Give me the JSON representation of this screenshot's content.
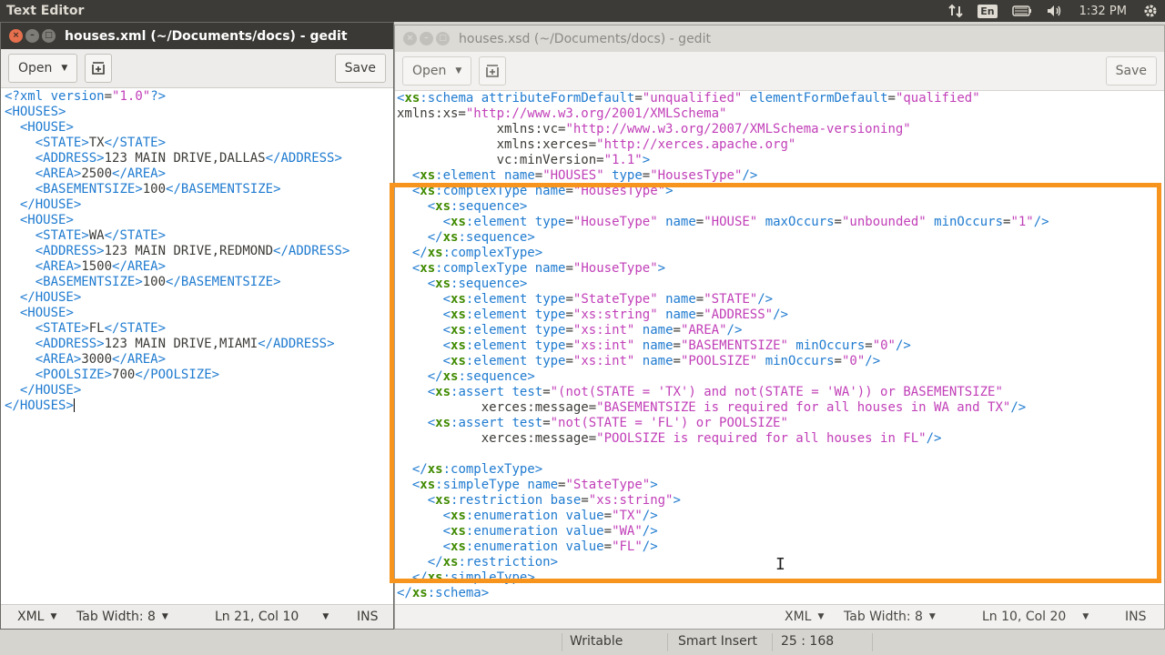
{
  "top_panel": {
    "title": "Text Editor",
    "lang": "En",
    "clock": "1:32 PM",
    "icons": [
      "network-updown-icon",
      "battery-icon",
      "volume-icon",
      "gear-icon"
    ]
  },
  "left_window": {
    "title": "houses.xml (~/Documents/docs) - gedit",
    "open_label": "Open",
    "save_label": "Save",
    "status": {
      "lang": "XML",
      "tab_width": "Tab Width: 8",
      "position": "Ln 21, Col 10",
      "mode": "INS"
    },
    "lines": [
      "<?xml version=\"1.0\"?>",
      "<HOUSES>",
      "  <HOUSE>",
      "    <STATE>TX</STATE>",
      "    <ADDRESS>123 MAIN DRIVE,DALLAS</ADDRESS>",
      "    <AREA>2500</AREA>",
      "    <BASEMENTSIZE>100</BASEMENTSIZE>",
      "  </HOUSE>",
      "  <HOUSE>",
      "    <STATE>WA</STATE>",
      "    <ADDRESS>123 MAIN DRIVE,REDMOND</ADDRESS>",
      "    <AREA>1500</AREA>",
      "    <BASEMENTSIZE>100</BASEMENTSIZE>",
      "  </HOUSE>",
      "  <HOUSE>",
      "    <STATE>FL</STATE>",
      "    <ADDRESS>123 MAIN DRIVE,MIAMI</ADDRESS>",
      "    <AREA>3000</AREA>",
      "    <POOLSIZE>700</POOLSIZE>",
      "  </HOUSE>",
      "</HOUSES>"
    ]
  },
  "right_window": {
    "title": "houses.xsd (~/Documents/docs) - gedit",
    "open_label": "Open",
    "save_label": "Save",
    "status": {
      "lang": "XML",
      "tab_width": "Tab Width: 8",
      "position": "Ln 10, Col 20",
      "mode": "INS"
    },
    "lines": [
      "<xs:schema attributeFormDefault=\"unqualified\" elementFormDefault=\"qualified\"",
      "xmlns:xs=\"http://www.w3.org/2001/XMLSchema\"",
      "             xmlns:vc=\"http://www.w3.org/2007/XMLSchema-versioning\"",
      "             xmlns:xerces=\"http://xerces.apache.org\"",
      "             vc:minVersion=\"1.1\">",
      "  <xs:element name=\"HOUSES\" type=\"HousesType\"/>",
      "  <xs:complexType name=\"HousesType\">",
      "    <xs:sequence>",
      "      <xs:element type=\"HouseType\" name=\"HOUSE\" maxOccurs=\"unbounded\" minOccurs=\"1\"/>",
      "    </xs:sequence>",
      "  </xs:complexType>",
      "  <xs:complexType name=\"HouseType\">",
      "    <xs:sequence>",
      "      <xs:element type=\"StateType\" name=\"STATE\"/>",
      "      <xs:element type=\"xs:string\" name=\"ADDRESS\"/>",
      "      <xs:element type=\"xs:int\" name=\"AREA\"/>",
      "      <xs:element type=\"xs:int\" name=\"BASEMENTSIZE\" minOccurs=\"0\"/>",
      "      <xs:element type=\"xs:int\" name=\"POOLSIZE\" minOccurs=\"0\"/>",
      "    </xs:sequence>",
      "    <xs:assert test=\"(not(STATE = 'TX') and not(STATE = 'WA')) or BASEMENTSIZE\"",
      "           xerces:message=\"BASEMENTSIZE is required for all houses in WA and TX\"/>",
      "    <xs:assert test=\"not(STATE = 'FL') or POOLSIZE\"",
      "           xerces:message=\"POOLSIZE is required for all houses in FL\"/>",
      "",
      "  </xs:complexType>",
      "  <xs:simpleType name=\"StateType\">",
      "    <xs:restriction base=\"xs:string\">",
      "      <xs:enumeration value=\"TX\"/>",
      "      <xs:enumeration value=\"WA\"/>",
      "      <xs:enumeration value=\"FL\"/>",
      "    </xs:restriction>",
      "  </xs:simpleType>",
      "</xs:schema>"
    ]
  },
  "background_status": {
    "writable": "Writable",
    "insert_mode": "Smart Insert",
    "position": "25 : 168"
  },
  "colors": {
    "highlight": "#f7941d",
    "tag": "#1f7bd0",
    "prefix": "#3f8a00",
    "value": "#c13fb8"
  }
}
